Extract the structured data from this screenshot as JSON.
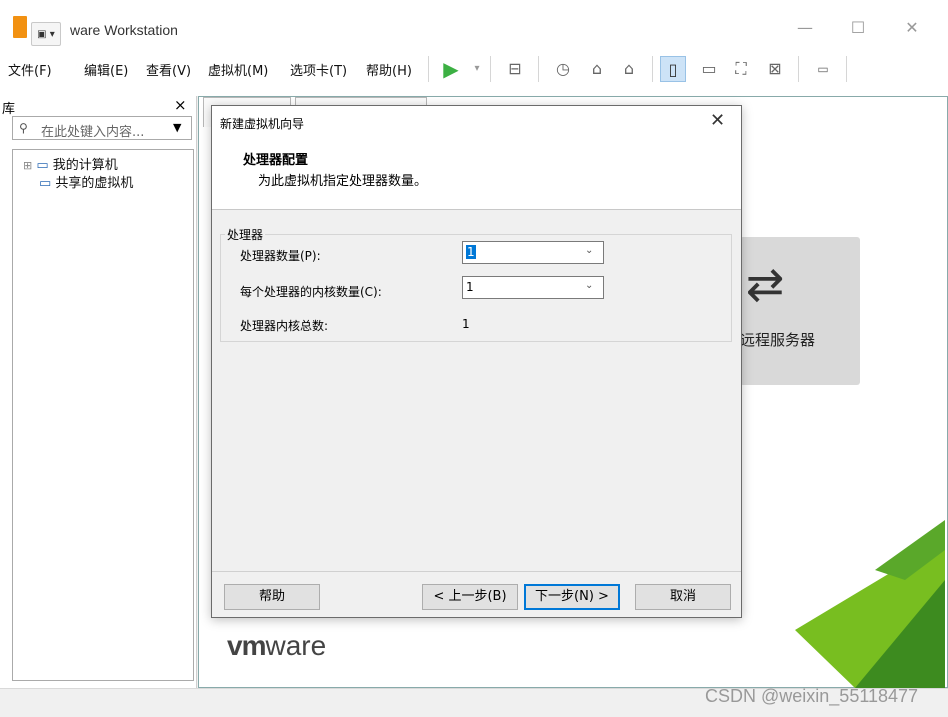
{
  "window": {
    "title": "VMware Workstation",
    "title_visible": "ware Workstation",
    "controls": {
      "minimize": "—",
      "maximize": "☐",
      "close": "✕"
    }
  },
  "menu": {
    "items": [
      "文件(F)",
      "编辑(E)",
      "查看(V)",
      "虚拟机(M)",
      "选项卡(T)",
      "帮助(H)"
    ]
  },
  "toolbar": {
    "icons": [
      "play-icon",
      "dropdown-icon",
      "send-keys-icon",
      "snapshot-icon",
      "revert-snapshot-icon",
      "manage-snapshots-icon",
      "sidebar-view-icon",
      "thumbnail-view-icon",
      "fullscreen-icon",
      "unity-icon",
      "console-icon"
    ]
  },
  "library": {
    "title": "库",
    "close": "×",
    "search_placeholder": "在此处键入内容...",
    "tree": [
      {
        "label": "我的计算机",
        "expander": "⊞"
      },
      {
        "label": "共享的虚拟机",
        "expander": ""
      }
    ]
  },
  "home": {
    "remote_label": "远程服务器",
    "remote_arrows": "⇄",
    "logo_vm": "vm",
    "logo_ware": "ware"
  },
  "dialog": {
    "title": "新建虚拟机向导",
    "close": "✕",
    "heading": "处理器配置",
    "subheading": "为此虚拟机指定处理器数量。",
    "group_label": "处理器",
    "fields": {
      "processor_count": {
        "label": "处理器数量(P):",
        "value": "1"
      },
      "cores_per_processor": {
        "label": "每个处理器的内核数量(C):",
        "value": "1"
      },
      "total_cores": {
        "label": "处理器内核总数:",
        "value": "1"
      }
    },
    "buttons": {
      "help": "帮助",
      "back": "< 上一步(B)",
      "next": "下一步(N) >",
      "cancel": "取消"
    }
  },
  "watermark": "CSDN @weixin_55118477",
  "colors": {
    "selection": "#0078d7",
    "logo_orange": "#f29111",
    "vmware_green_dark": "#3d8b1f",
    "vmware_green_light": "#78be20"
  }
}
